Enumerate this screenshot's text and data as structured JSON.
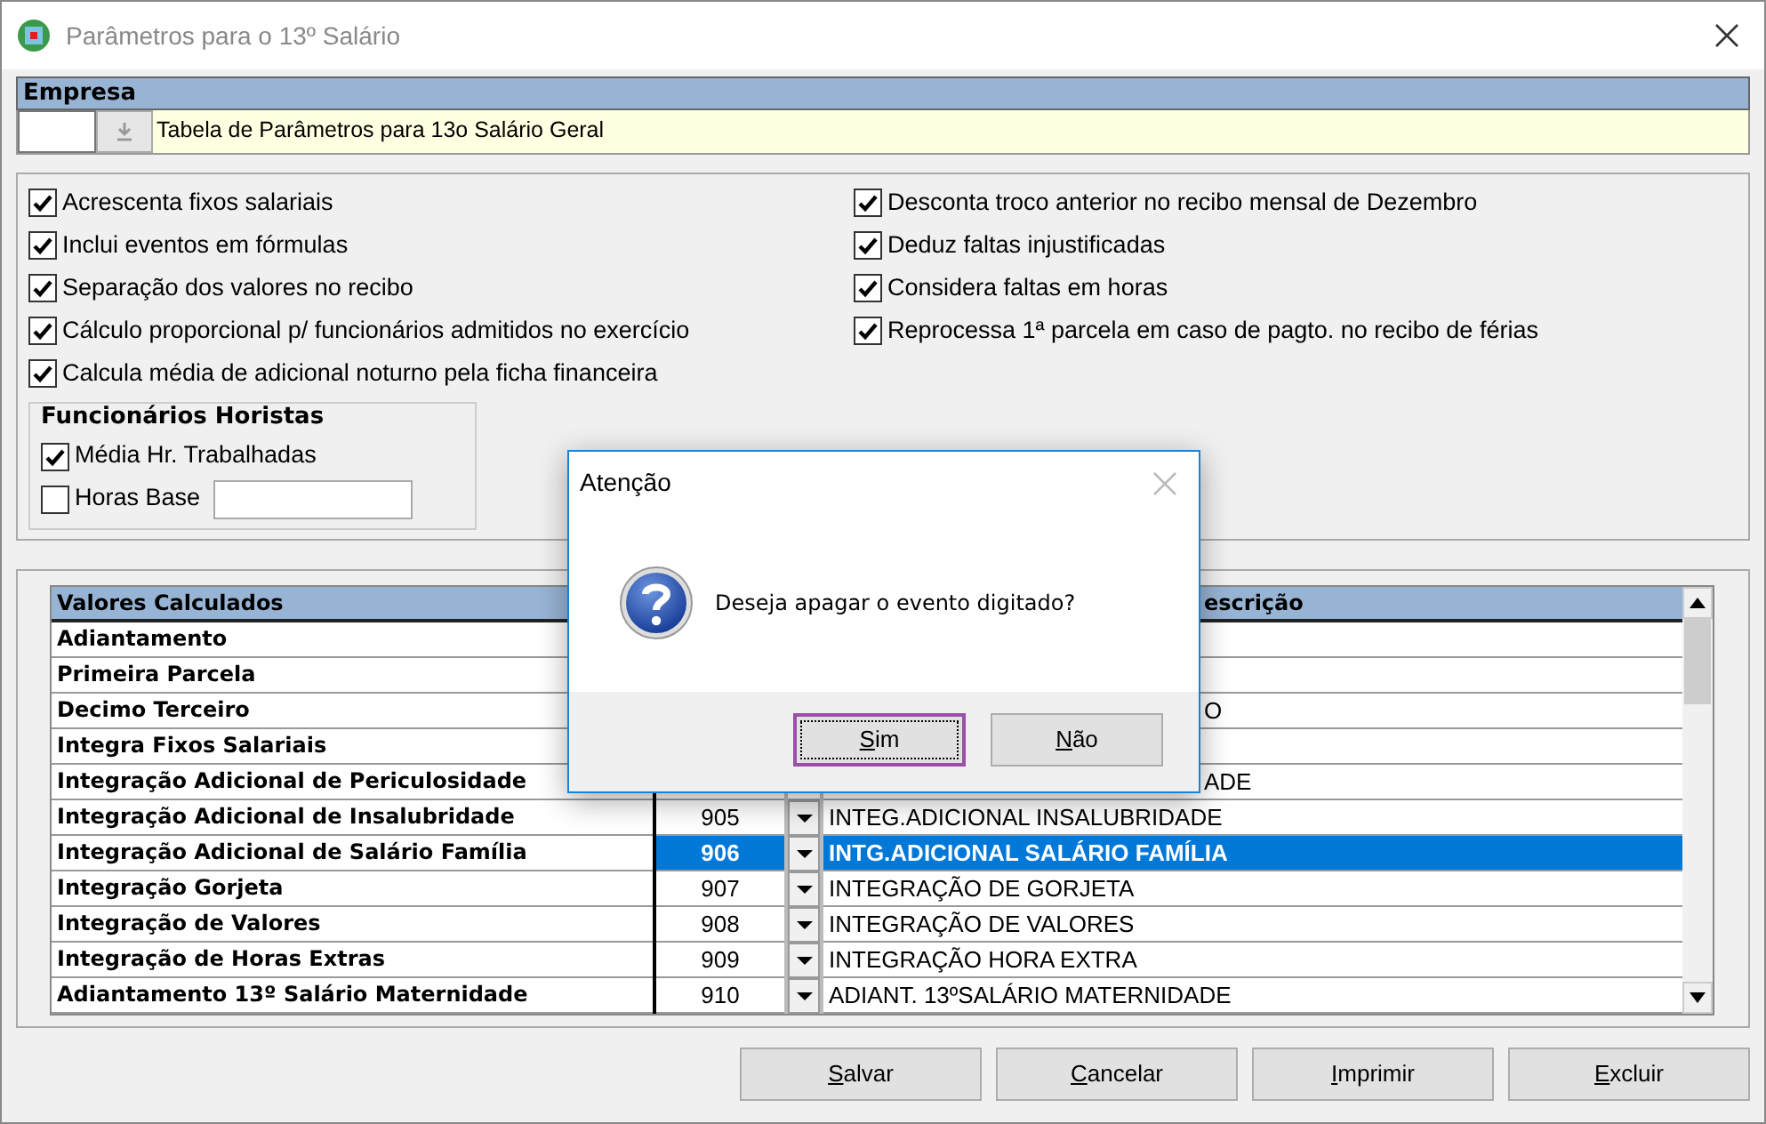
{
  "window": {
    "title": "Parâmetros para o 13º Salário"
  },
  "empresa": {
    "label": "Empresa",
    "description": "Tabela de Parâmetros para 13o Salário Geral"
  },
  "options_left": [
    {
      "label": "Acrescenta fixos salariais",
      "checked": true
    },
    {
      "label": "Inclui eventos em fórmulas",
      "checked": true
    },
    {
      "label": "Separação dos valores no recibo",
      "checked": true
    },
    {
      "label": "Cálculo proporcional p/ funcionários admitidos no exercício",
      "checked": true
    },
    {
      "label": "Calcula média de adicional noturno pela ficha financeira",
      "checked": true
    }
  ],
  "options_right": [
    {
      "label": "Desconta troco anterior no recibo mensal de Dezembro",
      "checked": true
    },
    {
      "label": "Deduz faltas injustificadas",
      "checked": true
    },
    {
      "label": "Considera faltas em horas",
      "checked": true
    },
    {
      "label": "Reprocessa 1ª parcela em caso de pagto. no recibo de férias",
      "checked": true
    }
  ],
  "horistas": {
    "title": "Funcionários Horistas",
    "options": [
      {
        "kind": "checkbox",
        "label": "Média Hr. Trabalhadas",
        "checked": true
      },
      {
        "kind": "checkbox_field",
        "label": "Horas Base",
        "checked": false
      }
    ]
  },
  "table": {
    "name_heading": "Valores Calculados",
    "description_heading": "escrição",
    "rows": [
      {
        "name": "Adiantamento",
        "selected": false
      },
      {
        "name": "Primeira Parcela",
        "selected": false
      },
      {
        "name": "Decimo Terceiro",
        "description": "O",
        "selected": false
      },
      {
        "name": "Integra Fixos Salariais",
        "selected": false
      },
      {
        "name": "Integração Adicional de Periculosidade",
        "description": "ADE",
        "selected": false
      },
      {
        "name": "Integração Adicional de Insalubridade",
        "code": "905",
        "description": "INTEG.ADICIONAL INSALUBRIDADE",
        "selected": false
      },
      {
        "name": "Integração Adicional de Salário Família",
        "code": "906",
        "description": "INTG.ADICIONAL SALÁRIO FAMÍLIA",
        "selected": true
      },
      {
        "name": "Integração Gorjeta",
        "code": "907",
        "description": "INTEGRAÇÃO DE GORJETA",
        "selected": false
      },
      {
        "name": "Integração de Valores",
        "code": "908",
        "description": "INTEGRAÇÃO DE VALORES",
        "selected": false
      },
      {
        "name": "Integração de Horas Extras",
        "code": "909",
        "description": "INTEGRAÇÃO HORA EXTRA",
        "selected": false
      },
      {
        "name": "Adiantamento 13º Salário Maternidade",
        "code": "910",
        "description": "ADIANT. 13ºSALÁRIO MATERNIDADE",
        "selected": false
      }
    ]
  },
  "buttons": [
    "Salvar",
    "Cancelar",
    "Imprimir",
    "Excluir"
  ],
  "dialog": {
    "title": "Atenção",
    "message": "Deseja apagar o evento digitado?",
    "buttons": [
      {
        "label": "Sim",
        "focused": true
      },
      {
        "label": "Não",
        "focused": false
      }
    ]
  }
}
